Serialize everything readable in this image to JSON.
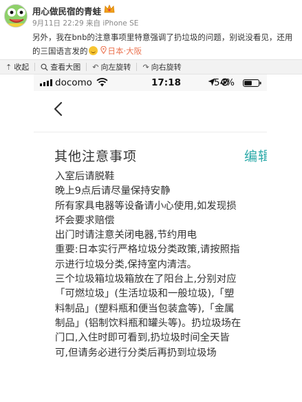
{
  "post": {
    "username": "用心做民宿的青蛙",
    "meta": "9月11日 22:29 来自 iPhone SE",
    "text": "另外，我在bnb的注意事项里特意强调了扔垃圾的问题，别说没看见，还用的三国语言发的",
    "location": "日本·大阪"
  },
  "toolbar": {
    "items": [
      {
        "icon": "collapse-icon",
        "label": "收起"
      },
      {
        "icon": "magnifier-icon",
        "label": "查看大图"
      },
      {
        "icon": "rotate-left-icon",
        "label": "向左旋转"
      },
      {
        "icon": "rotate-right-icon",
        "label": "向右旋转"
      }
    ]
  },
  "phone": {
    "carrier": "docomo",
    "time": "17:18",
    "battery": "54%",
    "section_title": "其他注意事项",
    "edit_label": "编辑",
    "notes": [
      "入室后请脱鞋",
      "晚上9点后请尽量保持安静",
      "所有家具电器等设备请小心使用,如发现损坏会要求赔偿",
      "出门时请注意关闭电器,节约用电",
      "重要:日本实行严格垃圾分类政策,请按照指示进行垃圾分类,保持室内清洁。",
      "三个垃圾箱垃圾箱放在了阳台上,分别对应「可燃垃圾」(生活垃圾和一般垃圾),「塑料制品」(塑料瓶和便当包装盒等),「金属制品」(铝制饮料瓶和罐头等)。扔垃圾场在门口,入住时即可看到,扔垃圾时间全天皆可,但请务必进行分类后再扔到垃圾场"
    ]
  },
  "colors": {
    "location": "#eb7350",
    "edit": "#2aa9a8",
    "toolbar_bg": "#f2f2f2"
  }
}
